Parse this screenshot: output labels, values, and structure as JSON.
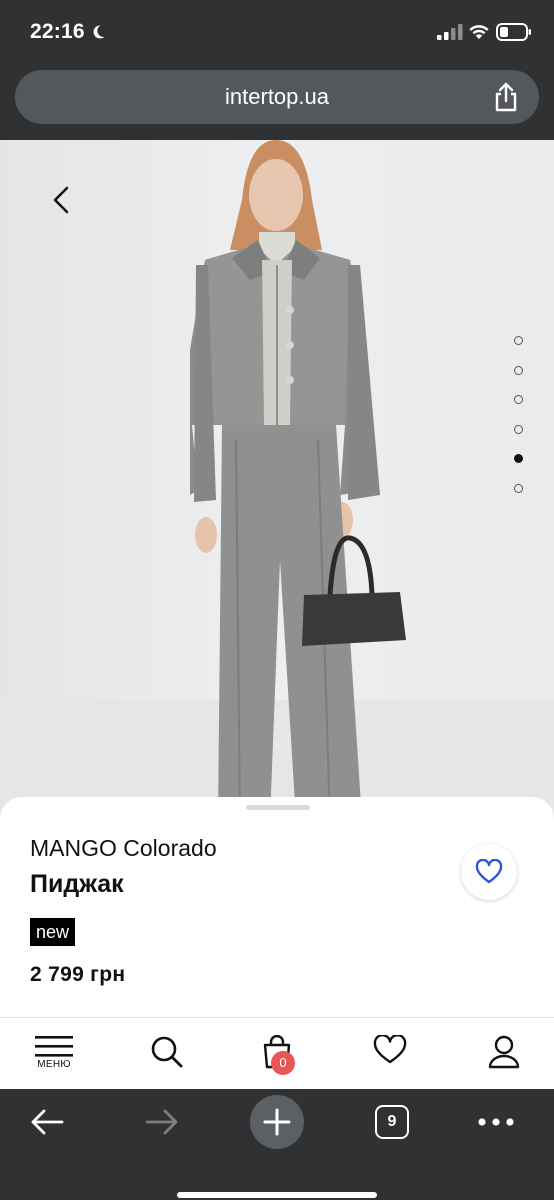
{
  "status_bar": {
    "time": "22:16",
    "icons": [
      "moon-icon",
      "signal-icon",
      "wifi-icon",
      "battery-icon"
    ]
  },
  "browser": {
    "url": "intertop.ua",
    "share_icon": "share-icon",
    "toolbar": {
      "back_icon": "arrow-left-icon",
      "forward_icon": "arrow-right-icon",
      "new_tab_icon": "plus-icon",
      "tab_count": "9",
      "more_icon": "ellipsis-icon"
    }
  },
  "gallery": {
    "image_count": 6,
    "active_index": 4,
    "back_icon": "chevron-left-icon"
  },
  "product": {
    "brand": "MANGO Colorado",
    "name": "Пиджак",
    "badge": "new",
    "price": "2 799 грн",
    "wishlist_icon": "heart-icon",
    "accent_color": "#2f55d4"
  },
  "site_nav": {
    "menu_label": "МЕНЮ",
    "cart_count": "0",
    "cart_badge_color": "#e85555",
    "items": [
      "menu-icon",
      "search-icon",
      "cart-icon",
      "favorites-icon",
      "profile-icon"
    ]
  }
}
